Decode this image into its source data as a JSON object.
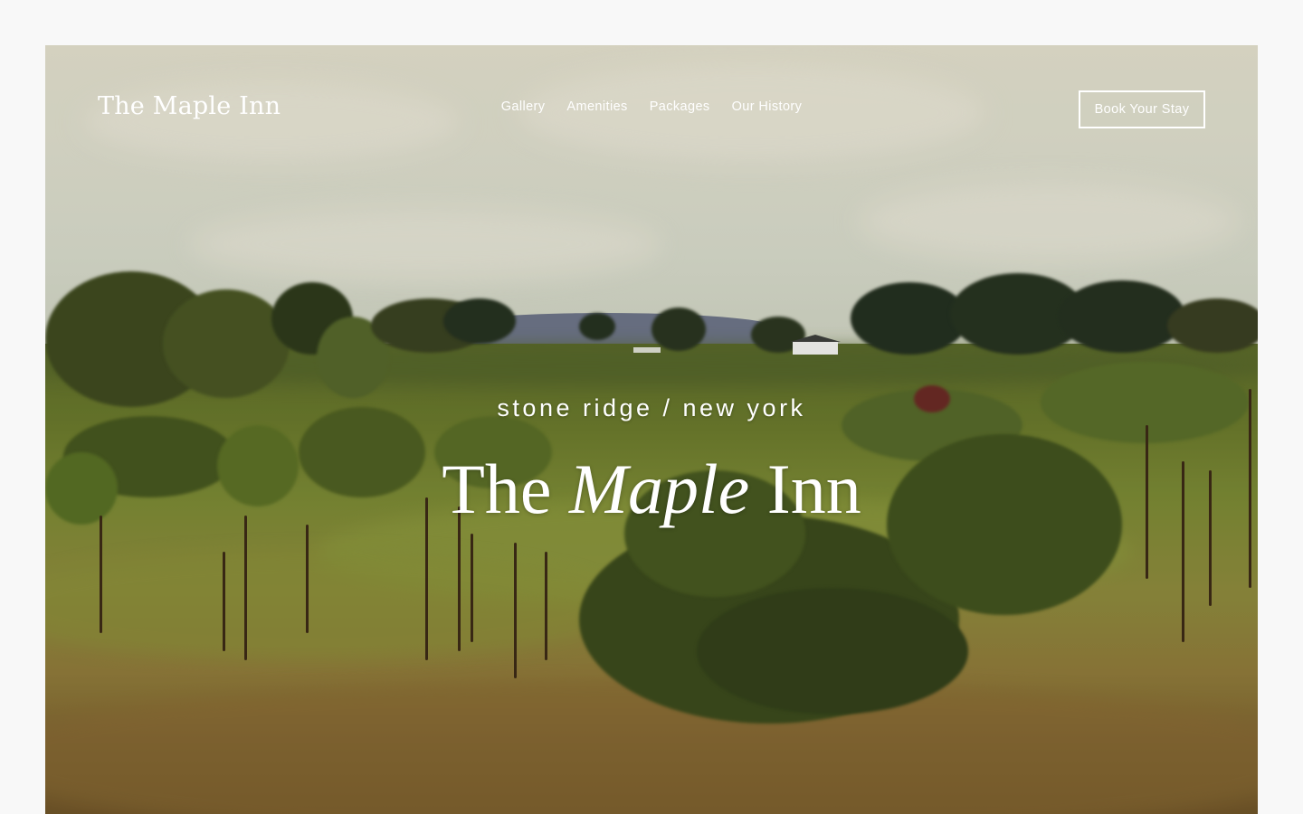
{
  "header": {
    "brand": "The Maple Inn",
    "nav": [
      {
        "label": "Gallery"
      },
      {
        "label": "Amenities"
      },
      {
        "label": "Packages"
      },
      {
        "label": "Our History"
      }
    ],
    "cta_label": "Book Your Stay"
  },
  "hero": {
    "location": "stone ridge / new york",
    "title_part1": "The",
    "title_part2": "Maple",
    "title_part3": "Inn",
    "image": "autumn-meadow-landscape"
  },
  "colors": {
    "page_bg": "#f8f8f8",
    "text_on_image": "#ffffff"
  }
}
